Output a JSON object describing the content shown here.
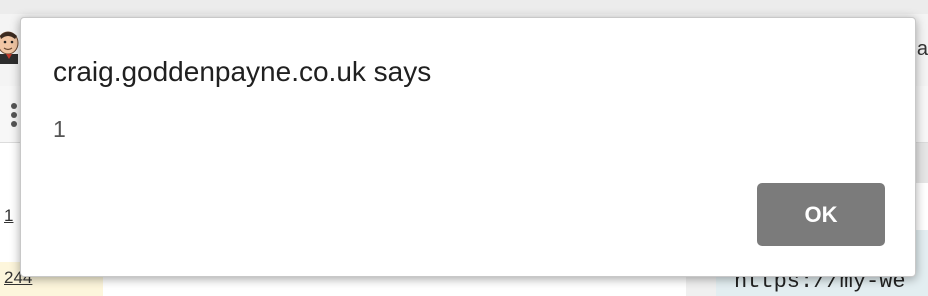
{
  "dialog": {
    "title": "craig.goddenpayne.co.uk says",
    "message": "1",
    "ok_label": "OK",
    "ok_color": "#7b7b7b"
  },
  "background": {
    "header_text_partial": "a",
    "row_numbers": [
      "1",
      "244"
    ],
    "code_text_partial": "https://my-we",
    "avatar_icon": "jenkins-butler-icon",
    "menu_icon": "kebab-menu-icon"
  }
}
